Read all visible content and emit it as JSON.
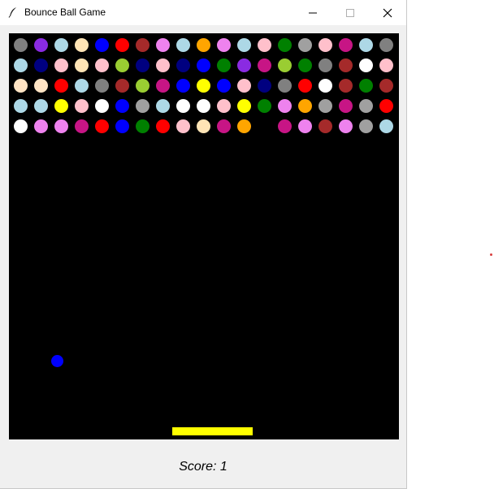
{
  "window": {
    "title": "Bounce Ball Game"
  },
  "game": {
    "score_label": "Score:",
    "score_value": "1",
    "ball_color": "#0000ff",
    "paddle_color": "#ffff00",
    "background_color": "#000000",
    "bricks": [
      [
        "#808080",
        "#8a2be2",
        "#add8e6",
        "#ffe4b5",
        "#0000ff",
        "#ff0000",
        "#a52a2a",
        "#ee82ee",
        "#add8e6",
        "#ffa500",
        "#ee82ee",
        "#add8e6",
        "#ffc0cb",
        "#008000",
        "#a0a0a0",
        "#ffc0cb",
        "#c71585",
        "#add8e6",
        "#808080"
      ],
      [
        "#add8e6",
        "#000080",
        "#ffc0cb",
        "#ffe4b5",
        "#ffc0cb",
        "#9acd32",
        "#000080",
        "#ffc0cb",
        "#000080",
        "#0000ff",
        "#008000",
        "#8a2be2",
        "#c71585",
        "#9acd32",
        "#008000",
        "#808080",
        "#a52a2a",
        "#ffffff",
        "#ffc0cb"
      ],
      [
        "#ffe4c4",
        "#ffe4c4",
        "#ff0000",
        "#add8e6",
        "#808080",
        "#a52a2a",
        "#9acd32",
        "#c71585",
        "#0000ff",
        "#ffff00",
        "#0000ff",
        "#ffc0cb",
        "#000080",
        "#808080",
        "#ff0000",
        "#ffffff",
        "#a52a2a",
        "#008000",
        "#a52a2a"
      ],
      [
        "#add8e6",
        "#add8e6",
        "#ffff00",
        "#ffc0cb",
        "#ffffff",
        "#0000ff",
        "#a0a0a0",
        "#add8e6",
        "#ffffff",
        "#ffffff",
        "#ffc0cb",
        "#ffff00",
        "#008000",
        "#ee82ee",
        "#ffa500",
        "#a0a0a0",
        "#c71585",
        "#a0a0a0",
        "#ff0000"
      ],
      [
        "#ffffff",
        "#ee82ee",
        "#ee82ee",
        "#c71585",
        "#ff0000",
        "#0000ff",
        "#008000",
        "#ff0000",
        "#ffc0cb",
        "#ffe4b5",
        "#c71585",
        "#ffa500",
        null,
        "#c71585",
        "#ee82ee",
        "#a52a2a",
        "#ee82ee",
        "#a0a0a0",
        "#add8e6"
      ]
    ]
  }
}
